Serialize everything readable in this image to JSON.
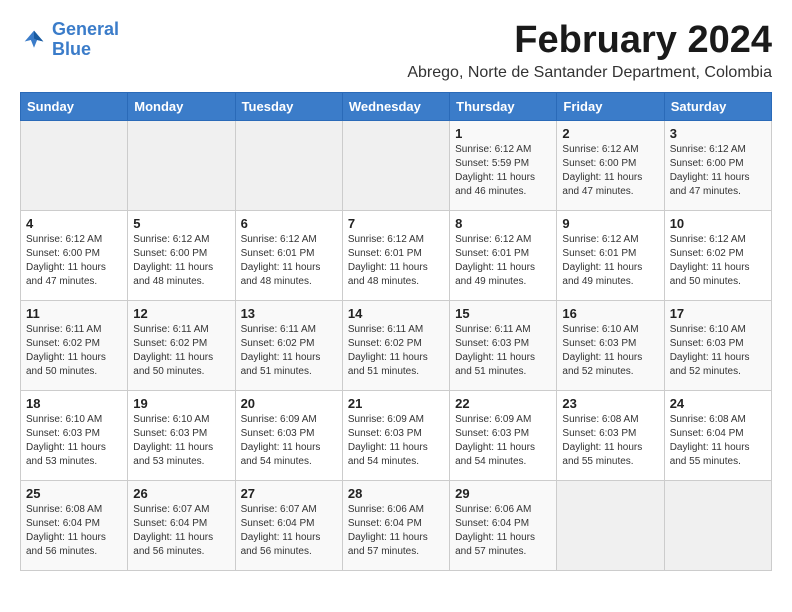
{
  "logo": {
    "text_general": "General",
    "text_blue": "Blue"
  },
  "title": "February 2024",
  "subtitle": "Abrego, Norte de Santander Department, Colombia",
  "days_of_week": [
    "Sunday",
    "Monday",
    "Tuesday",
    "Wednesday",
    "Thursday",
    "Friday",
    "Saturday"
  ],
  "weeks": [
    [
      {
        "day": "",
        "sunrise": "",
        "sunset": "",
        "daylight": "",
        "empty": true
      },
      {
        "day": "",
        "sunrise": "",
        "sunset": "",
        "daylight": "",
        "empty": true
      },
      {
        "day": "",
        "sunrise": "",
        "sunset": "",
        "daylight": "",
        "empty": true
      },
      {
        "day": "",
        "sunrise": "",
        "sunset": "",
        "daylight": "",
        "empty": true
      },
      {
        "day": "1",
        "sunrise": "Sunrise: 6:12 AM",
        "sunset": "Sunset: 5:59 PM",
        "daylight": "Daylight: 11 hours and 46 minutes.",
        "empty": false
      },
      {
        "day": "2",
        "sunrise": "Sunrise: 6:12 AM",
        "sunset": "Sunset: 6:00 PM",
        "daylight": "Daylight: 11 hours and 47 minutes.",
        "empty": false
      },
      {
        "day": "3",
        "sunrise": "Sunrise: 6:12 AM",
        "sunset": "Sunset: 6:00 PM",
        "daylight": "Daylight: 11 hours and 47 minutes.",
        "empty": false
      }
    ],
    [
      {
        "day": "4",
        "sunrise": "Sunrise: 6:12 AM",
        "sunset": "Sunset: 6:00 PM",
        "daylight": "Daylight: 11 hours and 47 minutes.",
        "empty": false
      },
      {
        "day": "5",
        "sunrise": "Sunrise: 6:12 AM",
        "sunset": "Sunset: 6:00 PM",
        "daylight": "Daylight: 11 hours and 48 minutes.",
        "empty": false
      },
      {
        "day": "6",
        "sunrise": "Sunrise: 6:12 AM",
        "sunset": "Sunset: 6:01 PM",
        "daylight": "Daylight: 11 hours and 48 minutes.",
        "empty": false
      },
      {
        "day": "7",
        "sunrise": "Sunrise: 6:12 AM",
        "sunset": "Sunset: 6:01 PM",
        "daylight": "Daylight: 11 hours and 48 minutes.",
        "empty": false
      },
      {
        "day": "8",
        "sunrise": "Sunrise: 6:12 AM",
        "sunset": "Sunset: 6:01 PM",
        "daylight": "Daylight: 11 hours and 49 minutes.",
        "empty": false
      },
      {
        "day": "9",
        "sunrise": "Sunrise: 6:12 AM",
        "sunset": "Sunset: 6:01 PM",
        "daylight": "Daylight: 11 hours and 49 minutes.",
        "empty": false
      },
      {
        "day": "10",
        "sunrise": "Sunrise: 6:12 AM",
        "sunset": "Sunset: 6:02 PM",
        "daylight": "Daylight: 11 hours and 50 minutes.",
        "empty": false
      }
    ],
    [
      {
        "day": "11",
        "sunrise": "Sunrise: 6:11 AM",
        "sunset": "Sunset: 6:02 PM",
        "daylight": "Daylight: 11 hours and 50 minutes.",
        "empty": false
      },
      {
        "day": "12",
        "sunrise": "Sunrise: 6:11 AM",
        "sunset": "Sunset: 6:02 PM",
        "daylight": "Daylight: 11 hours and 50 minutes.",
        "empty": false
      },
      {
        "day": "13",
        "sunrise": "Sunrise: 6:11 AM",
        "sunset": "Sunset: 6:02 PM",
        "daylight": "Daylight: 11 hours and 51 minutes.",
        "empty": false
      },
      {
        "day": "14",
        "sunrise": "Sunrise: 6:11 AM",
        "sunset": "Sunset: 6:02 PM",
        "daylight": "Daylight: 11 hours and 51 minutes.",
        "empty": false
      },
      {
        "day": "15",
        "sunrise": "Sunrise: 6:11 AM",
        "sunset": "Sunset: 6:03 PM",
        "daylight": "Daylight: 11 hours and 51 minutes.",
        "empty": false
      },
      {
        "day": "16",
        "sunrise": "Sunrise: 6:10 AM",
        "sunset": "Sunset: 6:03 PM",
        "daylight": "Daylight: 11 hours and 52 minutes.",
        "empty": false
      },
      {
        "day": "17",
        "sunrise": "Sunrise: 6:10 AM",
        "sunset": "Sunset: 6:03 PM",
        "daylight": "Daylight: 11 hours and 52 minutes.",
        "empty": false
      }
    ],
    [
      {
        "day": "18",
        "sunrise": "Sunrise: 6:10 AM",
        "sunset": "Sunset: 6:03 PM",
        "daylight": "Daylight: 11 hours and 53 minutes.",
        "empty": false
      },
      {
        "day": "19",
        "sunrise": "Sunrise: 6:10 AM",
        "sunset": "Sunset: 6:03 PM",
        "daylight": "Daylight: 11 hours and 53 minutes.",
        "empty": false
      },
      {
        "day": "20",
        "sunrise": "Sunrise: 6:09 AM",
        "sunset": "Sunset: 6:03 PM",
        "daylight": "Daylight: 11 hours and 54 minutes.",
        "empty": false
      },
      {
        "day": "21",
        "sunrise": "Sunrise: 6:09 AM",
        "sunset": "Sunset: 6:03 PM",
        "daylight": "Daylight: 11 hours and 54 minutes.",
        "empty": false
      },
      {
        "day": "22",
        "sunrise": "Sunrise: 6:09 AM",
        "sunset": "Sunset: 6:03 PM",
        "daylight": "Daylight: 11 hours and 54 minutes.",
        "empty": false
      },
      {
        "day": "23",
        "sunrise": "Sunrise: 6:08 AM",
        "sunset": "Sunset: 6:03 PM",
        "daylight": "Daylight: 11 hours and 55 minutes.",
        "empty": false
      },
      {
        "day": "24",
        "sunrise": "Sunrise: 6:08 AM",
        "sunset": "Sunset: 6:04 PM",
        "daylight": "Daylight: 11 hours and 55 minutes.",
        "empty": false
      }
    ],
    [
      {
        "day": "25",
        "sunrise": "Sunrise: 6:08 AM",
        "sunset": "Sunset: 6:04 PM",
        "daylight": "Daylight: 11 hours and 56 minutes.",
        "empty": false
      },
      {
        "day": "26",
        "sunrise": "Sunrise: 6:07 AM",
        "sunset": "Sunset: 6:04 PM",
        "daylight": "Daylight: 11 hours and 56 minutes.",
        "empty": false
      },
      {
        "day": "27",
        "sunrise": "Sunrise: 6:07 AM",
        "sunset": "Sunset: 6:04 PM",
        "daylight": "Daylight: 11 hours and 56 minutes.",
        "empty": false
      },
      {
        "day": "28",
        "sunrise": "Sunrise: 6:06 AM",
        "sunset": "Sunset: 6:04 PM",
        "daylight": "Daylight: 11 hours and 57 minutes.",
        "empty": false
      },
      {
        "day": "29",
        "sunrise": "Sunrise: 6:06 AM",
        "sunset": "Sunset: 6:04 PM",
        "daylight": "Daylight: 11 hours and 57 minutes.",
        "empty": false
      },
      {
        "day": "",
        "sunrise": "",
        "sunset": "",
        "daylight": "",
        "empty": true
      },
      {
        "day": "",
        "sunrise": "",
        "sunset": "",
        "daylight": "",
        "empty": true
      }
    ]
  ]
}
